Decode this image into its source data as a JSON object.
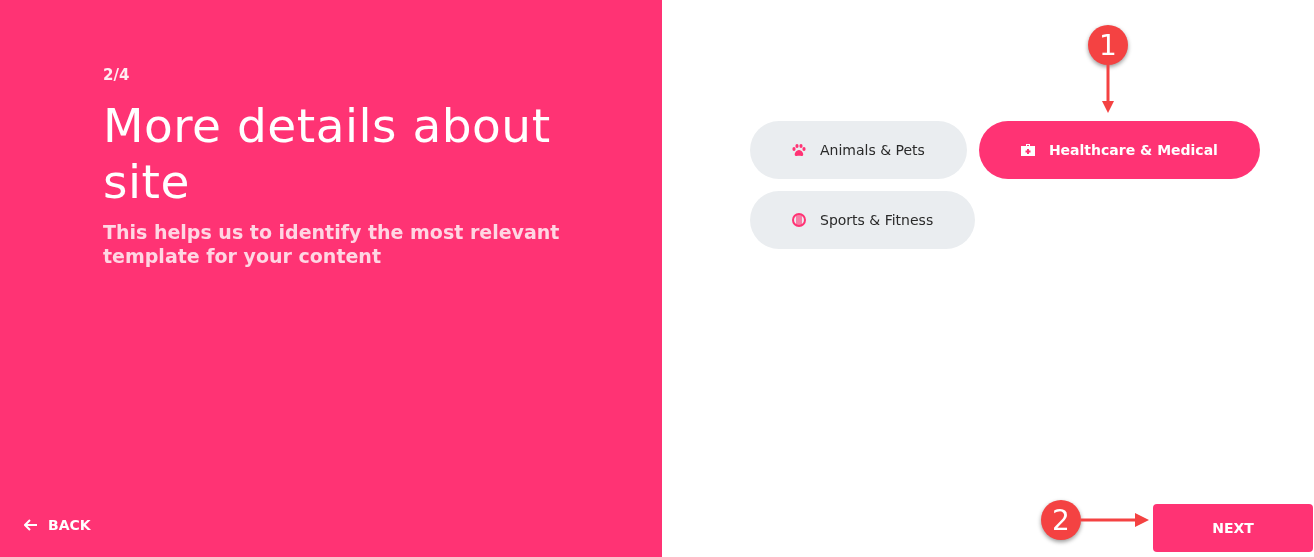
{
  "step": "2/4",
  "title": "More details about site",
  "subtitle": "This helps us to identify the most relevant template for your content",
  "back": {
    "label": "BACK"
  },
  "categories": [
    {
      "label": "Animals & Pets",
      "kind": "paw",
      "selected": false
    },
    {
      "label": "Healthcare & Medical",
      "kind": "medkit",
      "selected": true
    },
    {
      "label": "Sports & Fitness",
      "kind": "ball",
      "selected": false
    }
  ],
  "next": {
    "label": "NEXT"
  },
  "callouts": [
    {
      "number": "1",
      "kind": "down"
    },
    {
      "number": "2",
      "kind": "right"
    }
  ]
}
